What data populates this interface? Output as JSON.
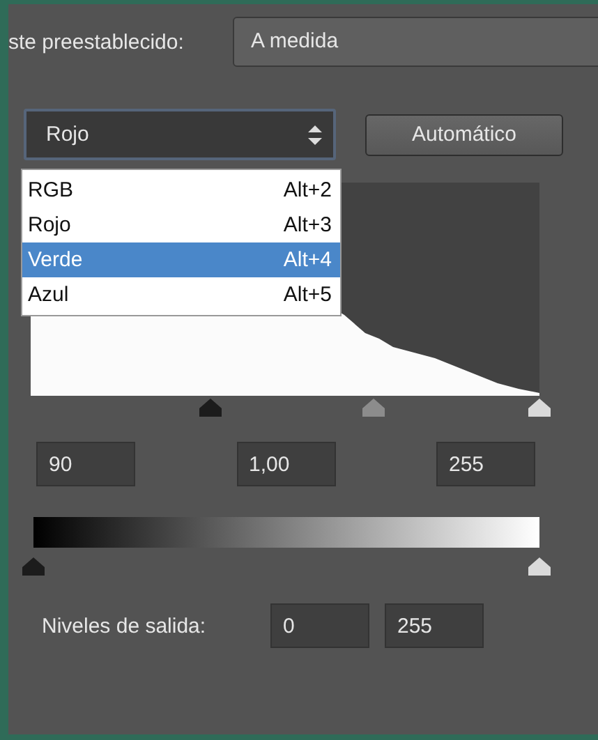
{
  "preset": {
    "label": "ste preestablecido:",
    "value": "A medida"
  },
  "channel": {
    "value": "Rojo"
  },
  "auto_button": "Automático",
  "channel_menu": [
    {
      "label": "RGB",
      "shortcut": "Alt+2",
      "selected": false
    },
    {
      "label": "Rojo",
      "shortcut": "Alt+3",
      "selected": false
    },
    {
      "label": "Verde",
      "shortcut": "Alt+4",
      "selected": true
    },
    {
      "label": "Azul",
      "shortcut": "Alt+5",
      "selected": false
    }
  ],
  "input_values": [
    "90",
    "1,00",
    "255"
  ],
  "output_label": "Niveles de salida:",
  "output_values": [
    "0",
    "255"
  ]
}
